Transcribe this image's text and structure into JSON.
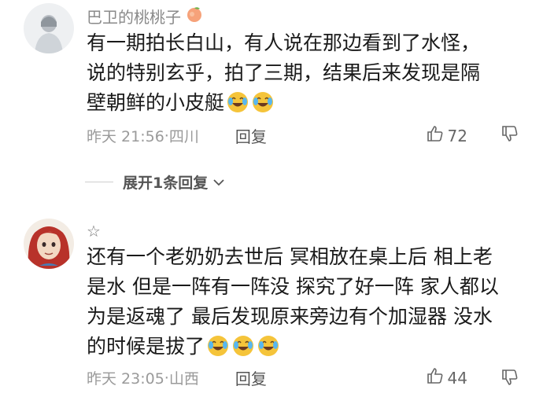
{
  "comments": [
    {
      "username": "巴卫的桃桃子",
      "badge_icon": "peach-icon",
      "lines": [
        "有一期拍长白山，有人说在那边看到了水怪，",
        "说的特别玄乎，拍了三期，结果后来发现是隔",
        "壁朝鲜的小皮艇"
      ],
      "time": "昨天 21:56",
      "location": "四川",
      "reply_label": "回复",
      "likes": "72",
      "emoji_count": 2
    },
    {
      "username": "",
      "badge_icon": "star-icon",
      "lines": [
        "还有一个老奶奶去世后 冥相放在桌上后 相上老",
        "是水 但是一阵有一阵没 探究了好一阵 家人都以",
        "为是返魂了 最后发现原来旁边有个加湿器 没水",
        "的时候是拔了"
      ],
      "time": "昨天 23:05",
      "location": "山西",
      "reply_label": "回复",
      "likes": "44",
      "emoji_count": 3
    }
  ],
  "expand_label": "展开1条回复",
  "star_glyph": "☆",
  "colors": {
    "text": "#1a1a1a",
    "meta": "#9a9a9a",
    "emoji": "#f5c43a"
  }
}
